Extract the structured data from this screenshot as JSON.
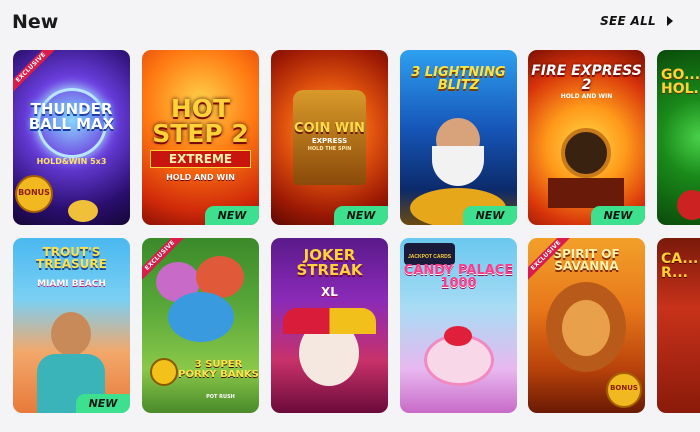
{
  "header": {
    "title": "New",
    "see_all": "SEE ALL"
  },
  "icons": {
    "see_all": "chevron-right-icon"
  },
  "colors": {
    "new_badge": "#3ce08e",
    "exclusive_ribbon": "#d91c4a"
  },
  "games": [
    {
      "name": "THUNDER BALL MAX",
      "tag": "HOLD&WIN 5x3",
      "ribbon": "EXCLUSIVE",
      "extra": "BONUS"
    },
    {
      "name": "HOT STEP 2",
      "tag": "EXTREME",
      "sub": "HOLD AND WIN",
      "badge": "NEW"
    },
    {
      "name": "COIN WIN",
      "tag": "EXPRESS",
      "sub": "HOLD THE SPIN",
      "badge": "NEW"
    },
    {
      "name": "3 LIGHTNING BLITZ",
      "badge": "NEW"
    },
    {
      "name": "FIRE EXPRESS 2",
      "sub": "HOLD AND WIN",
      "badge": "NEW"
    },
    {
      "name": "GO... HOL..."
    },
    {
      "name": "TROUT'S TREASURE",
      "tag": "MIAMI BEACH",
      "badge": "NEW"
    },
    {
      "name": "3 SUPER PORKY BANKS",
      "tag": "POT RUSH",
      "ribbon": "EXCLUSIVE"
    },
    {
      "name": "JOKER STREAK",
      "tag": "XL"
    },
    {
      "name": "CANDY PALACE 1000",
      "tag": "JACKPOT CARDS"
    },
    {
      "name": "SPIRIT OF SAVANNA",
      "ribbon": "EXCLUSIVE",
      "extra": "BONUS"
    },
    {
      "name": "CA... R..."
    }
  ]
}
